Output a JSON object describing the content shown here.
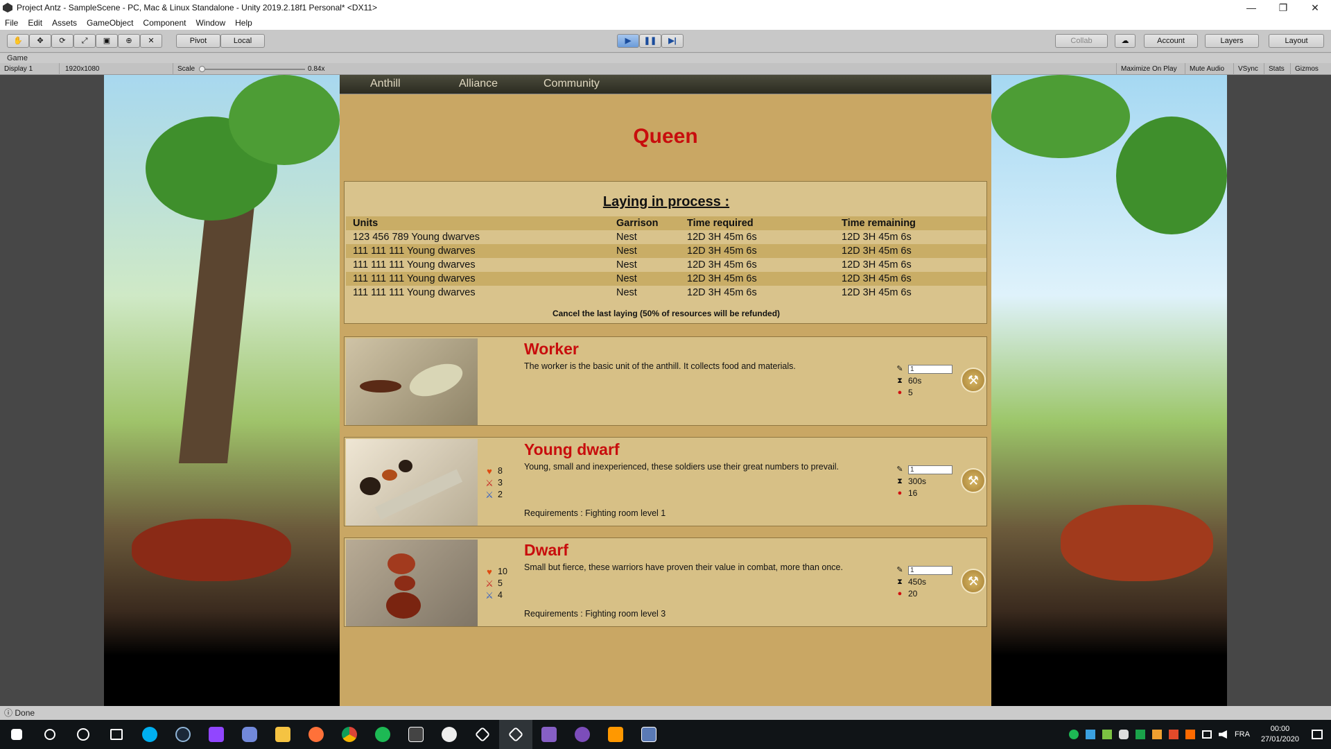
{
  "window": {
    "title": "Project Antz - SampleScene - PC, Mac & Linux Standalone - Unity 2019.2.18f1 Personal* <DX11>",
    "minimize": "—",
    "maximize": "❐",
    "close": "✕"
  },
  "menu": [
    "File",
    "Edit",
    "Assets",
    "GameObject",
    "Component",
    "Window",
    "Help"
  ],
  "toolbar": {
    "tools": [
      "✋",
      "✥",
      "⟳",
      "⤢",
      "▣",
      "⊕",
      "✕"
    ],
    "pivot": "Pivot",
    "local": "Local",
    "play": "▶",
    "pause": "❚❚",
    "step": "▶|",
    "collab": "Collab",
    "cloud": "☁",
    "account": "Account",
    "layers": "Layers",
    "layout": "Layout"
  },
  "game_tab": {
    "label": "Game"
  },
  "game_bar": {
    "display": "Display 1",
    "resolution": "1920x1080",
    "scale_label": "Scale",
    "scale_value": "0.84x",
    "maximize": "Maximize On Play",
    "mute": "Mute Audio",
    "vsync": "VSync",
    "stats": "Stats",
    "gizmos": "Gizmos"
  },
  "nav": {
    "tabs": [
      "Anthill",
      "Alliance",
      "Community"
    ]
  },
  "page_title": "Queen",
  "laying": {
    "title": "Laying in process :",
    "headers": [
      "Units",
      "Garrison",
      "Time required",
      "Time remaining"
    ],
    "rows": [
      [
        "123 456 789 Young dwarves",
        "Nest",
        "12D 3H 45m 6s",
        "12D 3H 45m 6s"
      ],
      [
        "111 111 111 Young dwarves",
        "Nest",
        "12D 3H 45m 6s",
        "12D 3H 45m 6s"
      ],
      [
        "111 111 111 Young dwarves",
        "Nest",
        "12D 3H 45m 6s",
        "12D 3H 45m 6s"
      ],
      [
        "111 111 111 Young dwarves",
        "Nest",
        "12D 3H 45m 6s",
        "12D 3H 45m 6s"
      ],
      [
        "111 111 111 Young dwarves",
        "Nest",
        "12D 3H 45m 6s",
        "12D 3H 45m 6s"
      ]
    ],
    "cancel": "Cancel the last laying (50% of resources will be refunded)"
  },
  "units": [
    {
      "name": "Worker",
      "desc": "The worker is the basic unit of the anthill. It collects food and materials.",
      "hp": "",
      "atk": "",
      "def": "",
      "req": "",
      "qty": "1",
      "time": "60s",
      "food": "5"
    },
    {
      "name": "Young dwarf",
      "desc": "Young, small and inexperienced, these soldiers use their great numbers to prevail.",
      "hp": "8",
      "atk": "3",
      "def": "2",
      "req": "Requirements : Fighting room level 1",
      "qty": "1",
      "time": "300s",
      "food": "16"
    },
    {
      "name": "Dwarf",
      "desc": "Small but fierce, these warriors have proven their value in combat, more than once.",
      "hp": "10",
      "atk": "5",
      "def": "4",
      "req": "Requirements : Fighting room level 3",
      "qty": "1",
      "time": "450s",
      "food": "20"
    }
  ],
  "status": {
    "text": "Done"
  },
  "taskbar": {
    "lang": "FRA",
    "time": "00:00",
    "date": "27/01/2020"
  },
  "colors": {
    "accent_red": "#c80d0d",
    "panel": "#c9a764",
    "card": "#d7c086"
  }
}
